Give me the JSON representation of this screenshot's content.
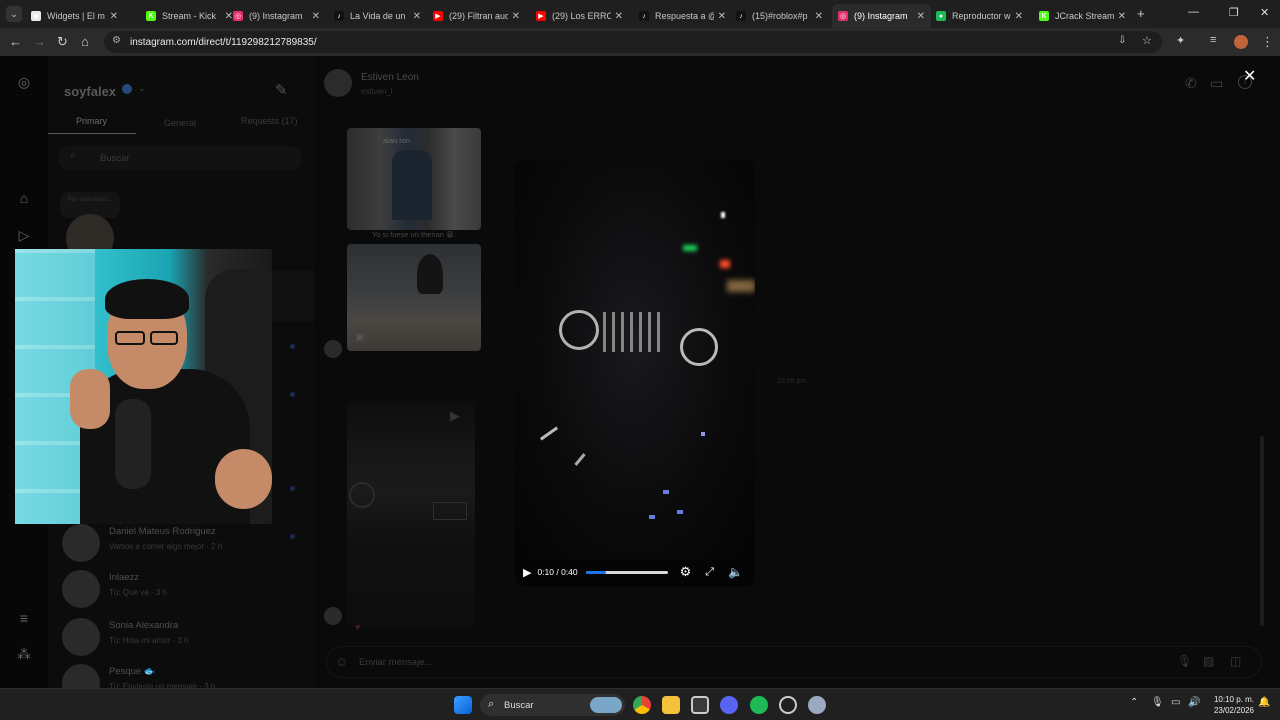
{
  "browser": {
    "tabs": [
      {
        "title": "Widgets | El m",
        "color": "#e8eaed",
        "glyph": "◆"
      },
      {
        "title": "Stream - Kick",
        "color": "#53fc18",
        "glyph": "K"
      },
      {
        "title": "(9) Instagram",
        "color": "#e1306c",
        "glyph": "◎"
      },
      {
        "title": "La Vida de un",
        "color": "#111111",
        "glyph": "♪"
      },
      {
        "title": "(29) Filtran aud",
        "color": "#ff0000",
        "glyph": "▶"
      },
      {
        "title": "(29) Los ERRO",
        "color": "#ff0000",
        "glyph": "▶"
      },
      {
        "title": "Respuesta a @",
        "color": "#111111",
        "glyph": "♪"
      },
      {
        "title": "(15)#roblox#p",
        "color": "#111111",
        "glyph": "♪"
      },
      {
        "title": "(9) Instagram",
        "color": "#e1306c",
        "glyph": "◎"
      },
      {
        "title": "Reproductor w",
        "color": "#1db954",
        "glyph": "●"
      },
      {
        "title": "JCrack Stream",
        "color": "#53fc18",
        "glyph": "K"
      }
    ],
    "url": "instagram.com/direct/t/119298212789835/"
  },
  "instagram": {
    "username": "soyfalex",
    "filters": [
      "Primary",
      "General",
      "Requests (17)"
    ],
    "search_placeholder": "Buscar",
    "note": "Por coincidad...",
    "conversations": [
      {
        "name": "Daniel Mateus Rodriguez",
        "message": "Vamos a comer algo mejor",
        "time": "2 h"
      },
      {
        "name": "Inlaezz",
        "message": "Tú: Que va",
        "time": "3 h"
      },
      {
        "name": "Sonia Alexandra",
        "message": "Tú: Hola mi amor",
        "time": "3 h"
      },
      {
        "name": "Pesque 🐟",
        "message": "Tú: Enviaste un mensaje",
        "time": "3 h"
      }
    ],
    "chat": {
      "contact_name": "Estiven Leon",
      "contact_handle": "estiven_l",
      "reel_caption_top": "alan ron",
      "reel_caption": "Yo si fuese un therian 😁:",
      "timestamp": "10:08 pm",
      "message_placeholder": "Enviar mensaje..."
    }
  },
  "video_player": {
    "time_display": "0:10 / 0:40",
    "progress": 0.25
  },
  "taskbar": {
    "search_label": "Buscar",
    "time": "10:10 p. m.",
    "date": "23/02/2026"
  }
}
